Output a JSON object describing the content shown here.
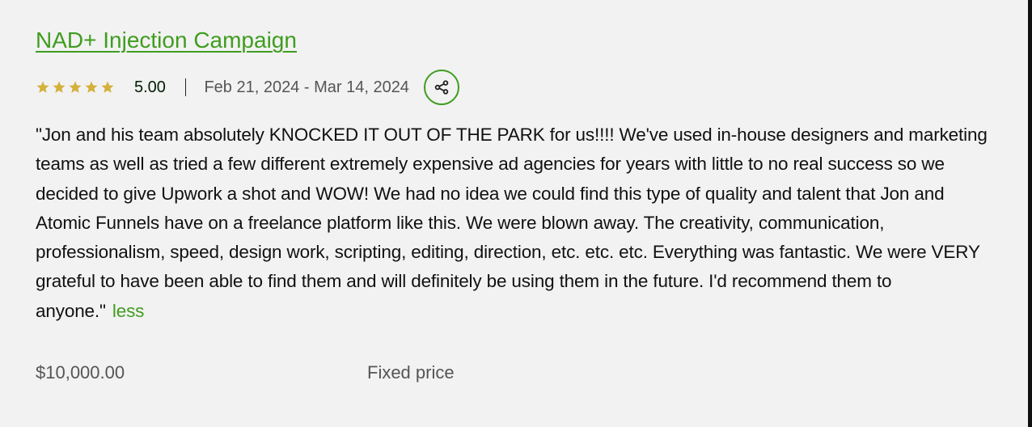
{
  "review": {
    "title": "NAD+ Injection Campaign",
    "stars": 5,
    "star_color": "#d4b13d",
    "rating": "5.00",
    "dates": "Feb 21, 2024 - Mar 14, 2024",
    "share_icon": "share-icon",
    "text": "\"Jon and his team absolutely KNOCKED IT OUT OF THE PARK for us!!!! We've used in-house designers and marketing teams as well as tried a few different extremely expensive ad agencies for years with little to no real success so we decided to give Upwork a shot and WOW! We had no idea we could find this type of quality and talent that Jon and Atomic Funnels have on a freelance platform like this. We were blown away. The creativity, communication, professionalism, speed, design work, scripting, editing, direction, etc. etc. etc. Everything was fantastic. We were VERY grateful to have been able to find them and will definitely be using them in the future. I'd recommend them to anyone.\"",
    "less_label": "less",
    "amount": "$10,000.00",
    "price_type": "Fixed price"
  },
  "colors": {
    "accent": "#3f9d1f",
    "background": "#f2f2f2",
    "muted_text": "#555555"
  }
}
